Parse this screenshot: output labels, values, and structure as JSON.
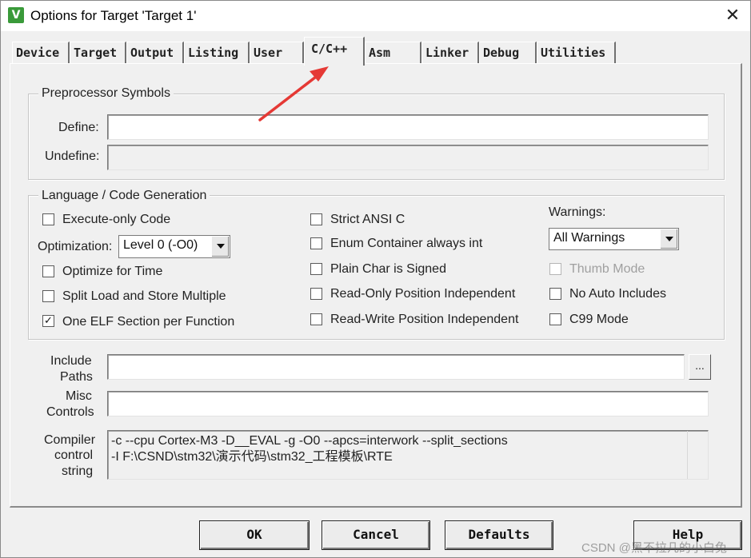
{
  "window": {
    "title": "Options for Target 'Target 1'",
    "app_icon": "keil-uvision-icon",
    "close_glyph": "✕"
  },
  "tabs": [
    {
      "label": "Device"
    },
    {
      "label": "Target"
    },
    {
      "label": "Output"
    },
    {
      "label": "Listing"
    },
    {
      "label": "User"
    },
    {
      "label": "C/C++",
      "active": true
    },
    {
      "label": "Asm"
    },
    {
      "label": "Linker"
    },
    {
      "label": "Debug"
    },
    {
      "label": "Utilities"
    }
  ],
  "preprocessor": {
    "group_label": "Preprocessor Symbols",
    "define_label": "Define:",
    "define_value": "",
    "undefine_label": "Undefine:",
    "undefine_value": ""
  },
  "language": {
    "group_label": "Language / Code Generation",
    "execute_only": {
      "label": "Execute-only Code",
      "checked": false
    },
    "optimization_label": "Optimization:",
    "optimization_value": "Level 0 (-O0)",
    "optimize_time": {
      "label": "Optimize for Time",
      "checked": false
    },
    "split_load": {
      "label": "Split Load and Store Multiple",
      "checked": false
    },
    "one_elf": {
      "label": "One ELF Section per Function",
      "checked": true
    },
    "strict_ansi": {
      "label": "Strict ANSI C",
      "checked": false
    },
    "enum_container": {
      "label": "Enum Container always int",
      "checked": false
    },
    "plain_char": {
      "label": "Plain Char is Signed",
      "checked": false
    },
    "ropi": {
      "label": "Read-Only Position Independent",
      "checked": false
    },
    "rwpi": {
      "label": "Read-Write Position Independent",
      "checked": false
    },
    "warnings_label": "Warnings:",
    "warnings_value": "All Warnings",
    "thumb_mode": {
      "label": "Thumb Mode",
      "checked": false,
      "disabled": true
    },
    "no_auto_includes": {
      "label": "No Auto Includes",
      "checked": false
    },
    "c99_mode": {
      "label": "C99 Mode",
      "checked": false
    }
  },
  "paths": {
    "include_label_1": "Include",
    "include_label_2": "Paths",
    "include_value": "",
    "browse_label": "...",
    "misc_label_1": "Misc",
    "misc_label_2": "Controls",
    "misc_value": "",
    "compiler_label_1": "Compiler",
    "compiler_label_2": "control",
    "compiler_label_3": "string",
    "compiler_line_1": "-c --cpu Cortex-M3 -D__EVAL -g -O0 --apcs=interwork --split_sections",
    "compiler_line_2": "-I F:\\CSND\\stm32\\演示代码\\stm32_工程模板\\RTE"
  },
  "buttons": {
    "ok": "OK",
    "cancel": "Cancel",
    "defaults": "Defaults",
    "help": "Help"
  },
  "annotation": {
    "color": "#e53935"
  },
  "watermark": "CSDN @黑不拉几的小白兔"
}
